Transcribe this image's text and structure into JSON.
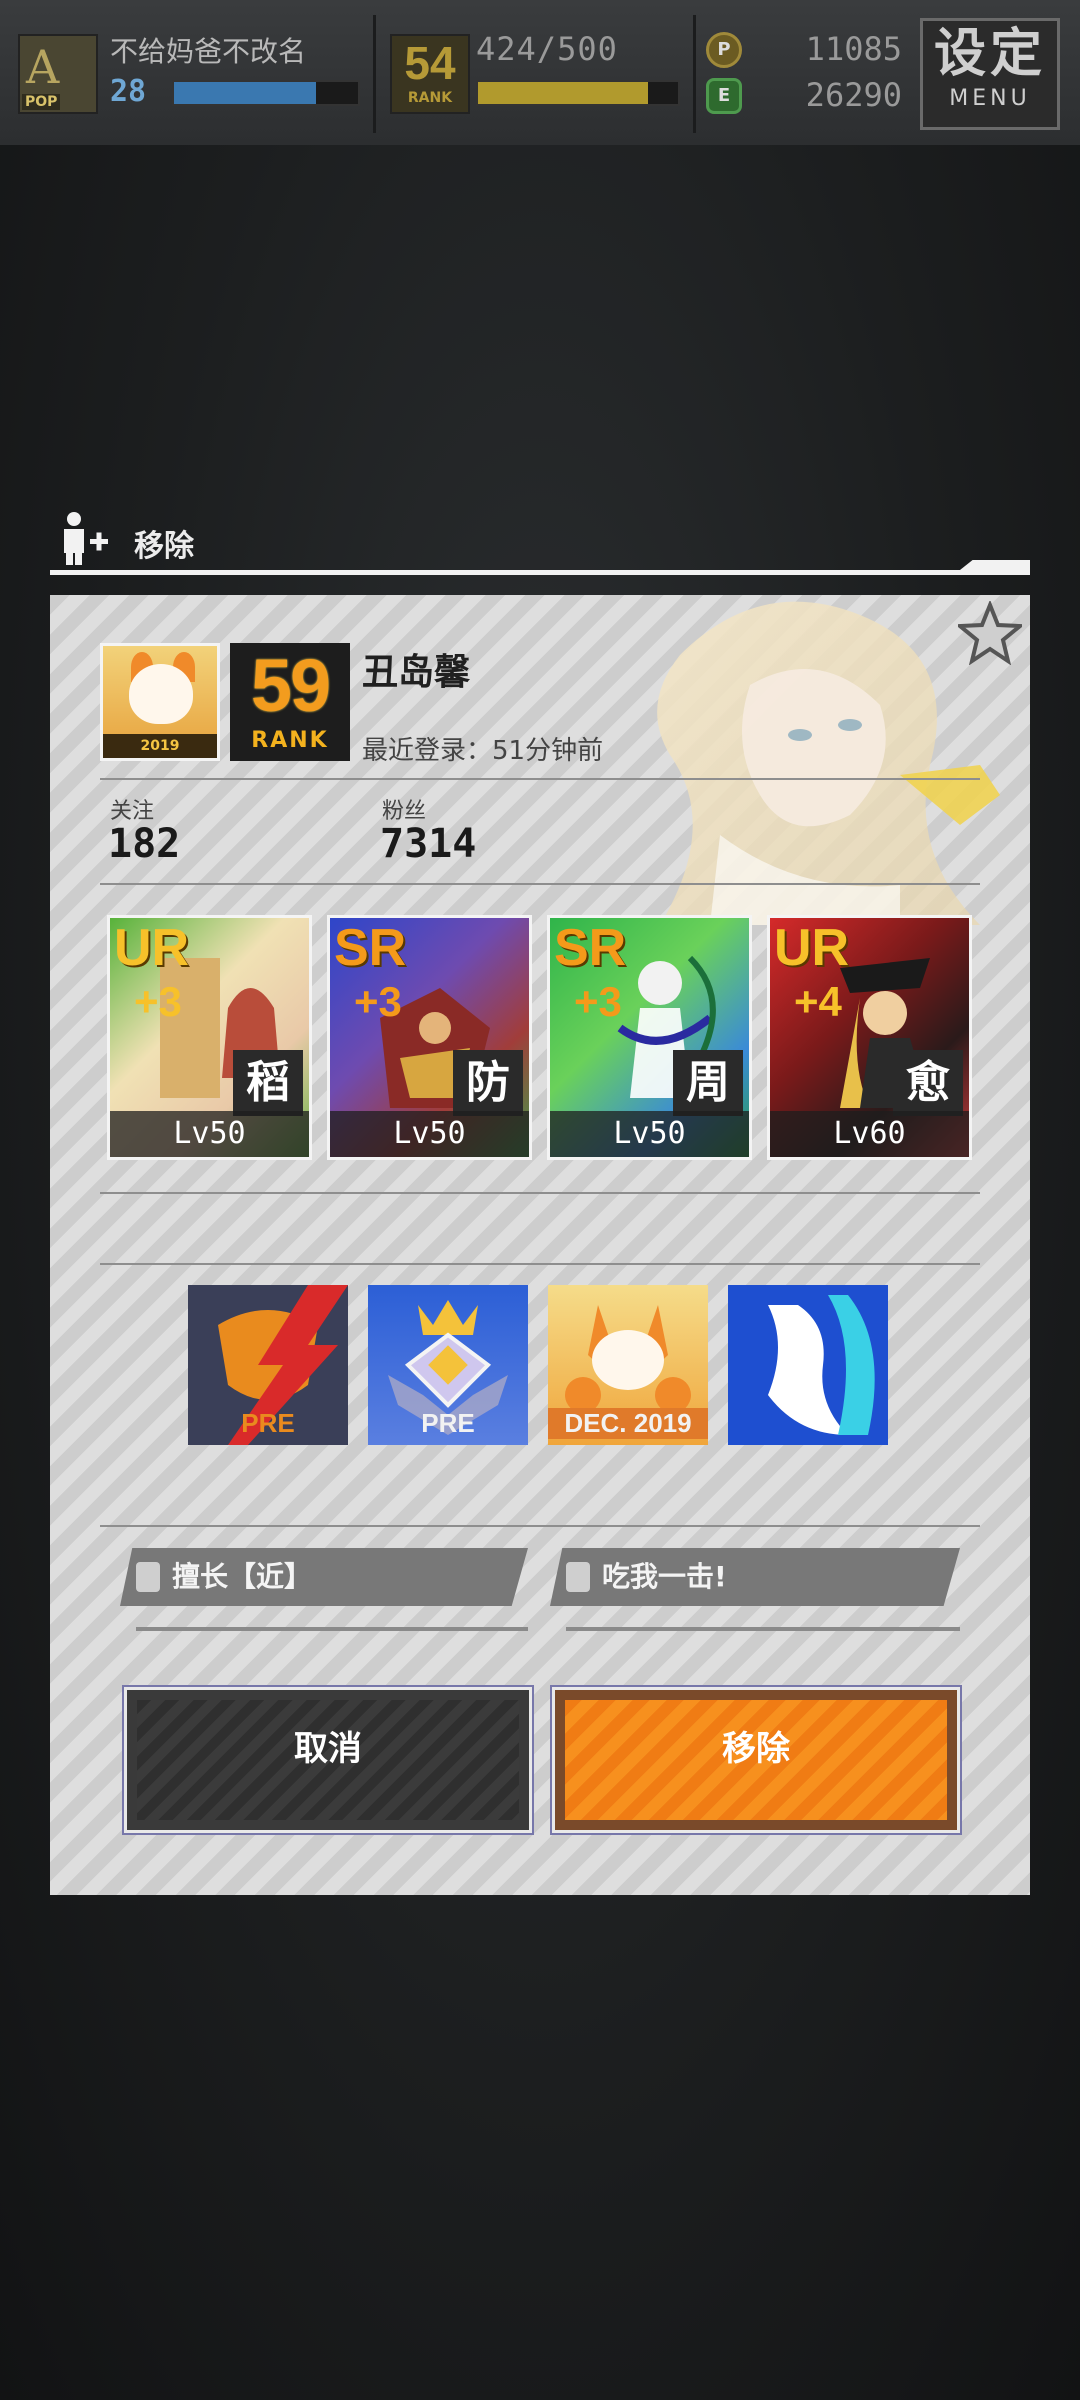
{
  "topbar": {
    "player_name": "不给妈爸不改名",
    "player_level": "28",
    "player_level_progress": 0.77,
    "avatar_tag": "POP",
    "rank": "54",
    "rank_label": "RANK",
    "xp": "424/500",
    "xp_progress": 0.85,
    "currency_p": "11085",
    "currency_e": "26290",
    "menu_big": "设定",
    "menu_small": "MENU"
  },
  "dialog": {
    "title": "移除",
    "user_name": "丑岛馨",
    "user_rank": "59",
    "user_rank_label": "RANK",
    "badge_year": "2019",
    "last_login": "最近登录：51分钟前",
    "follow_label": "关注",
    "follow_value": "182",
    "fans_label": "粉丝",
    "fans_value": "7314",
    "cards": [
      {
        "rarity": "UR",
        "plus": "+3",
        "type": "稻",
        "level": "Lv50",
        "rarity_color": "#f7c12a"
      },
      {
        "rarity": "SR",
        "plus": "+3",
        "type": "防",
        "level": "Lv50",
        "rarity_color": "#f49a1a"
      },
      {
        "rarity": "SR",
        "plus": "+3",
        "type": "周",
        "level": "Lv50",
        "rarity_color": "#f49a1a"
      },
      {
        "rarity": "UR",
        "plus": "+4",
        "type": "愈",
        "level": "Lv60",
        "rarity_color": "#f7c12a"
      }
    ],
    "badges": [
      {
        "text": "PRE",
        "color": "#e98b1e"
      },
      {
        "text": "PRE",
        "color": "#f2f2f2"
      },
      {
        "text": "DEC. 2019",
        "color": "#f2f2f2"
      },
      {
        "text": "",
        "color": "#ffffff"
      }
    ],
    "tag_left": "擅长【近】",
    "tag_right": "吃我一击!",
    "cancel_label": "取消",
    "remove_label": "移除"
  }
}
